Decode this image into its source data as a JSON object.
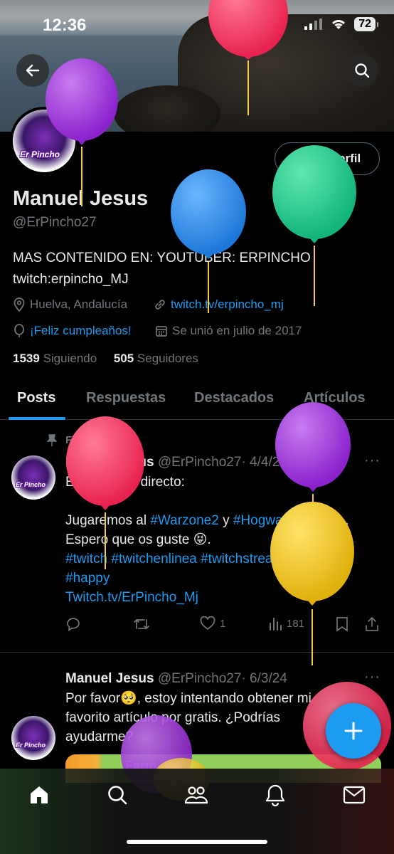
{
  "status": {
    "time": "12:36",
    "battery": "72"
  },
  "profile": {
    "name": "Manuel Jesus",
    "handle": "@ErPincho27",
    "avatar_text": "Er Pincho",
    "edit_label": "Editar perfil",
    "bio_line1": "MAS CONTENIDO EN: YOUTUBER: ERPINCHO",
    "bio_line2": "twitch:erpincho_MJ",
    "location": "Huelva, Andalucía",
    "website": "twitch.tv/erpincho_mj",
    "birthday": "¡Feliz cumpleaños!",
    "joined": "Se unió en julio de 2017",
    "following_count": "1539",
    "following_label": "Siguiendo",
    "followers_count": "505",
    "followers_label": "Seguidores"
  },
  "tabs": [
    {
      "label": "Posts"
    },
    {
      "label": "Respuestas"
    },
    {
      "label": "Destacados"
    },
    {
      "label": "Artículos"
    }
  ],
  "posts": [
    {
      "pinned_label": "Fijada",
      "name": "Manuel Jesus",
      "handle": "@ErPincho27",
      "date": "· 4/4/23",
      "line1": "Estamos en directo:",
      "line2a": "Jugaremos al ",
      "tag1": "#Warzone2",
      "line2b": " y ",
      "tag2": "#HogwartsLegacy",
      "line2c": " .",
      "line3": "Espero que os guste 😝.",
      "tags_line": "#twitch #twitchenlinea #twitchstreamer",
      "tag_happy": "#happy",
      "link": "Twitch.tv/ErPincho_Mj",
      "likes": "1",
      "views": "181"
    },
    {
      "name": "Manuel Jesus",
      "handle": "@ErPincho27",
      "date": "· 6/3/24",
      "line1": "Por favor🥺, estoy intentando obtener mi",
      "line2": "favorito artículo por gratis. ¿Podrías",
      "line3": "ayudarme?",
      "card_text": "Farm"
    }
  ],
  "colors": {
    "accent": "#1d9bf0",
    "bg": "#000000"
  }
}
